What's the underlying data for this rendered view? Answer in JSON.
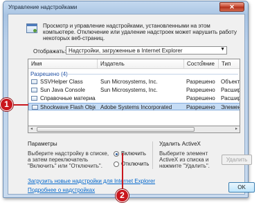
{
  "window": {
    "title": "Управление надстройками",
    "close_glyph": "✕"
  },
  "header": {
    "description": "Просмотр и управление надстройками, установленными на этом компьютере. Отключение или удаление надстроек может нарушить работу некоторых веб-страниц."
  },
  "filter": {
    "label": "Отображать:",
    "selected": "Надстройки, загруженные в Internet Explorer",
    "arrow_glyph": "▼"
  },
  "list": {
    "columns": [
      "Имя",
      "Издатель",
      "Состояние",
      "Тип"
    ],
    "sort_glyph": "▲",
    "group": "Разрешено (4)",
    "rows": [
      {
        "name": "SSVHelper Class",
        "publisher": "Sun Microsystems, Inc.",
        "status": "Разрешено",
        "type": "Объект м"
      },
      {
        "name": "Sun Java Console",
        "publisher": "Sun Microsystems, Inc.",
        "status": "Разрешено",
        "type": "Расширен"
      },
      {
        "name": "Справочные материалы",
        "publisher": "",
        "status": "Разрешено",
        "type": "Расширен"
      },
      {
        "name": "Shockwave Flash Object",
        "publisher": "Adobe Systems Incorporated",
        "status": "Разрешено",
        "type": "Элемент А"
      }
    ],
    "selected_row": 3,
    "scroll_left": "◂",
    "scroll_right": "▸"
  },
  "settings": {
    "title": "Параметры",
    "description": "Выберите надстройку в списке, а затем переключатель \"Включить\" или \"Отключить\".",
    "enable_label": "Включить",
    "disable_label": "Отключить",
    "enable_selected": true
  },
  "remove": {
    "title": "Удалить ActiveX",
    "description": "Выберите элемент ActiveX из списка и нажмите \"Удалить\".",
    "button_label": "Удалить"
  },
  "links": {
    "download": "Загрузить новые надстройки для Internet Explorer",
    "more_info": "Подробнее о надстройках"
  },
  "ok_button": "OK",
  "callouts": {
    "first": "1",
    "second": "2"
  }
}
